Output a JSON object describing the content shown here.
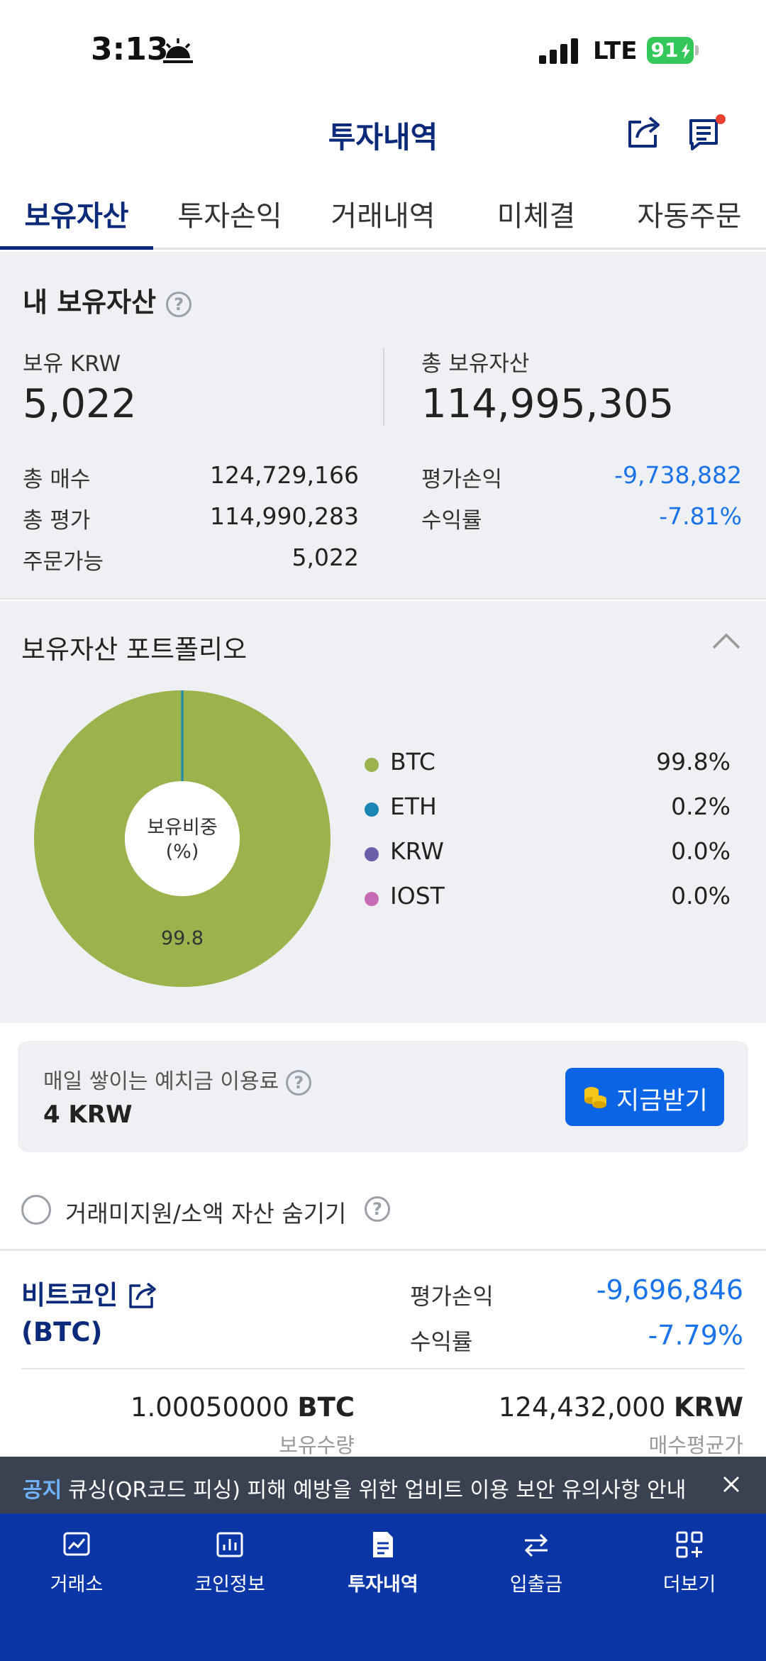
{
  "status_bar": {
    "time": "3:13",
    "network": "LTE",
    "battery": "91"
  },
  "header": {
    "title": "투자내역"
  },
  "tabs": [
    {
      "label": "보유자산",
      "active": true
    },
    {
      "label": "투자손익",
      "active": false
    },
    {
      "label": "거래내역",
      "active": false
    },
    {
      "label": "미체결",
      "active": false
    },
    {
      "label": "자동주문",
      "active": false
    }
  ],
  "summary": {
    "title": "내 보유자산",
    "krw_label": "보유 KRW",
    "krw_value": "5,022",
    "total_label": "총 보유자산",
    "total_value": "114,995,305",
    "rows_left": [
      {
        "label": "총 매수",
        "value": "124,729,166"
      },
      {
        "label": "총 평가",
        "value": "114,990,283"
      },
      {
        "label": "주문가능",
        "value": "5,022"
      }
    ],
    "rows_right": [
      {
        "label": "평가손익",
        "value": "-9,738,882"
      },
      {
        "label": "수익률",
        "value": "-7.81%"
      }
    ]
  },
  "portfolio": {
    "title": "보유자산 포트폴리오",
    "center_label_line1": "보유비중",
    "center_label_line2": "(%)",
    "slice_label": "99.8",
    "legend": [
      {
        "name": "BTC",
        "value": "99.8%",
        "color": "#9bb24d"
      },
      {
        "name": "ETH",
        "value": "0.2%",
        "color": "#1c86b3"
      },
      {
        "name": "KRW",
        "value": "0.0%",
        "color": "#6b5ea8"
      },
      {
        "name": "IOST",
        "value": "0.0%",
        "color": "#c66bb5"
      }
    ]
  },
  "interest": {
    "label": "매일 쌓이는 예치금 이용료",
    "value": "4 KRW",
    "button_label": "지금받기"
  },
  "hide_option": {
    "label": "거래미지원/소액 자산 숨기기"
  },
  "coin": {
    "name_line1": "비트코인",
    "name_line2": "(BTC)",
    "pnl_label": "평가손익",
    "pnl_value": "-9,696,846",
    "rate_label": "수익률",
    "rate_value": "-7.79%",
    "qty_number": "1.00050000",
    "qty_unit": "BTC",
    "qty_label": "보유수량",
    "avg_number": "124,432,000",
    "avg_unit": "KRW",
    "avg_label": "매수평균가"
  },
  "notice": {
    "tag": "공지",
    "text": "큐싱(QR코드 피싱) 피해 예방을 위한 업비트 이용 보안 유의사항 안내"
  },
  "bottom_nav": [
    {
      "label": "거래소",
      "icon": "exchange-chart-icon",
      "active": false
    },
    {
      "label": "코인정보",
      "icon": "bar-chart-icon",
      "active": false
    },
    {
      "label": "투자내역",
      "icon": "document-icon",
      "active": true
    },
    {
      "label": "입출금",
      "icon": "transfer-arrows-icon",
      "active": false
    },
    {
      "label": "더보기",
      "icon": "grid-plus-icon",
      "active": false
    }
  ]
}
